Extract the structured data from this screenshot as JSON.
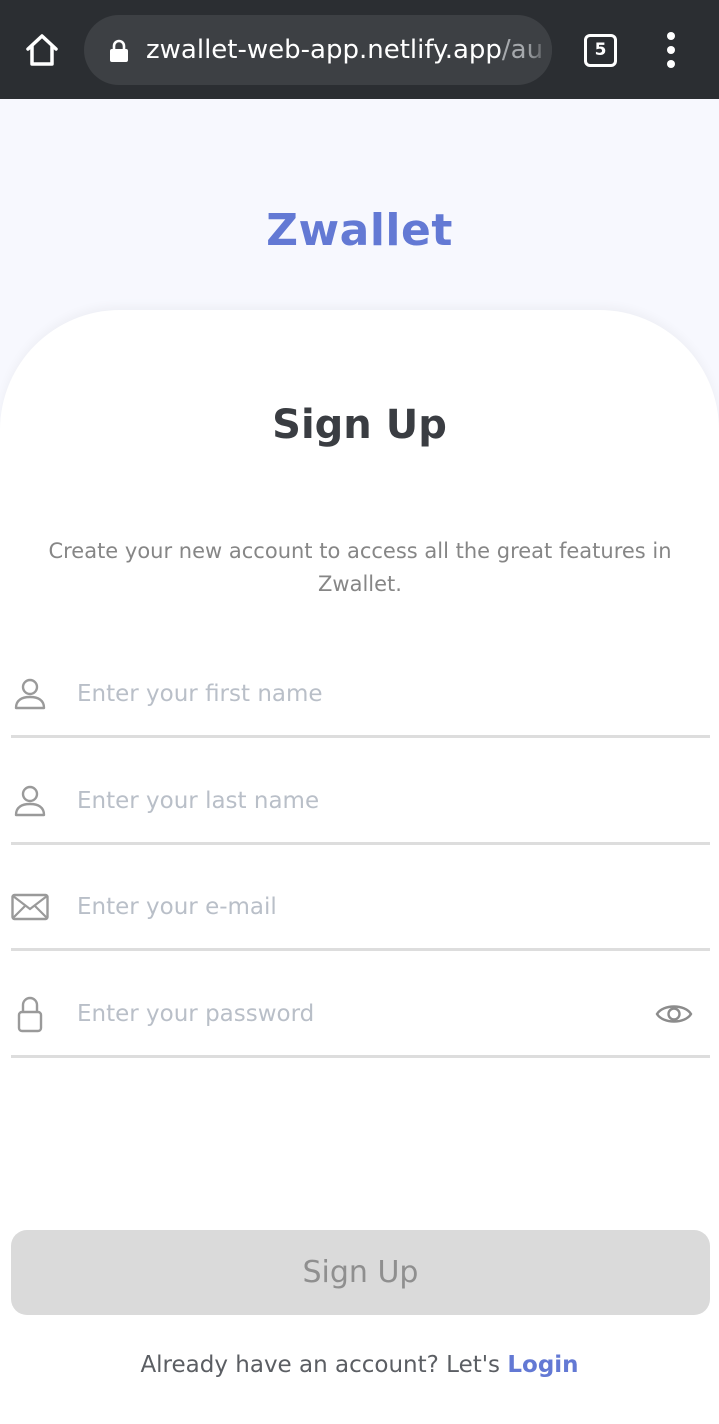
{
  "browser": {
    "url_host": "zwallet-web-app.netlify.app",
    "url_path": "/au",
    "tab_count": "5",
    "icons": {
      "home": "home-icon",
      "lock": "lock-icon",
      "menu": "kebab-menu-icon"
    }
  },
  "brand": {
    "name": "Zwallet",
    "color": "#6379d4"
  },
  "form": {
    "title": "Sign Up",
    "subtitle": "Create your new account to access all the great features in Zwallet.",
    "fields": [
      {
        "name": "first-name",
        "placeholder": "Enter your first name",
        "value": "",
        "icon": "user-icon"
      },
      {
        "name": "last-name",
        "placeholder": "Enter your last name",
        "value": "",
        "icon": "user-icon"
      },
      {
        "name": "email",
        "placeholder": "Enter your e-mail",
        "value": "",
        "icon": "mail-icon"
      },
      {
        "name": "password",
        "placeholder": "Enter your password",
        "value": "",
        "icon": "lock-icon",
        "toggle_icon": "eye-icon"
      }
    ],
    "submit_label": "Sign Up",
    "submit_enabled": false
  },
  "footer": {
    "prompt": "Already have an account? Let's",
    "link_label": "Login"
  }
}
